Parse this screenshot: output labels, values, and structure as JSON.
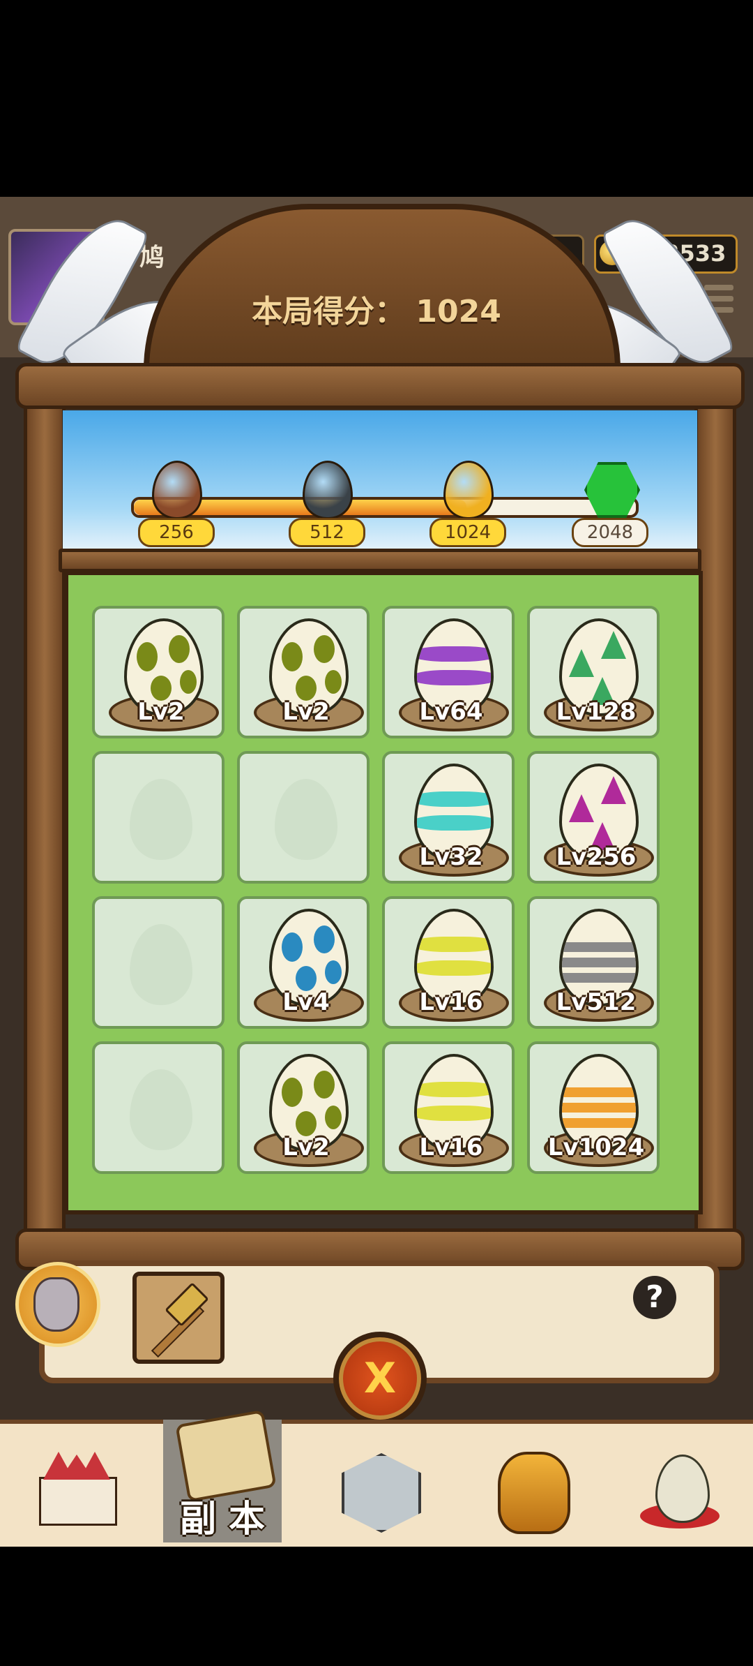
{
  "header": {
    "player_name": "鸠",
    "coins": "72533"
  },
  "score": {
    "label": "本局得分：",
    "value": "1024"
  },
  "progress": {
    "fraction": 0.67,
    "milestones": [
      {
        "label": "256",
        "reached": true,
        "icon": "bronze-egg-icon",
        "color": "#8a4a2a"
      },
      {
        "label": "512",
        "reached": true,
        "icon": "dark-egg-icon",
        "color": "#3a4248"
      },
      {
        "label": "1024",
        "reached": true,
        "icon": "golden-egg-icon",
        "color": "#f0b020"
      },
      {
        "label": "2048",
        "reached": false,
        "icon": "green-gem-icon",
        "color": "#27c23a"
      }
    ]
  },
  "board": {
    "cells": [
      {
        "level": "Lv2",
        "pattern": "spots",
        "color": "#7a8a18"
      },
      {
        "level": "Lv2",
        "pattern": "spots",
        "color": "#7a8a18"
      },
      {
        "level": "Lv64",
        "pattern": "waves",
        "color": "#9a4ac8"
      },
      {
        "level": "Lv128",
        "pattern": "triangles",
        "color": "#3aa860"
      },
      {
        "level": "",
        "pattern": "empty",
        "color": ""
      },
      {
        "level": "",
        "pattern": "empty",
        "color": ""
      },
      {
        "level": "Lv32",
        "pattern": "waves",
        "color": "#4ad0c8"
      },
      {
        "level": "Lv256",
        "pattern": "triangles",
        "color": "#b02a9a"
      },
      {
        "level": "",
        "pattern": "empty",
        "color": ""
      },
      {
        "level": "Lv4",
        "pattern": "spots",
        "color": "#2a8ac0"
      },
      {
        "level": "Lv16",
        "pattern": "waves",
        "color": "#e0e040"
      },
      {
        "level": "Lv512",
        "pattern": "stripes",
        "color": "#8a8a8a"
      },
      {
        "level": "",
        "pattern": "empty",
        "color": ""
      },
      {
        "level": "Lv2",
        "pattern": "spots",
        "color": "#7a8a18"
      },
      {
        "level": "Lv16",
        "pattern": "waves",
        "color": "#e0e040"
      },
      {
        "level": "Lv1024",
        "pattern": "stripes",
        "color": "#f0a030"
      }
    ]
  },
  "tools": {
    "hammer_icon": "hammer-icon",
    "help_label": "?",
    "close_label": "X"
  },
  "nav": {
    "items": [
      {
        "name": "nav-castle",
        "label": "",
        "icon": "castle-icon"
      },
      {
        "name": "nav-dungeon",
        "label": "副 本",
        "icon": "map-scroll-icon",
        "active": true
      },
      {
        "name": "nav-battle",
        "label": "",
        "icon": "crossed-swords-icon"
      },
      {
        "name": "nav-hero",
        "label": "",
        "icon": "golden-helmet-icon"
      },
      {
        "name": "nav-egg",
        "label": "",
        "icon": "egg-icon"
      }
    ]
  }
}
